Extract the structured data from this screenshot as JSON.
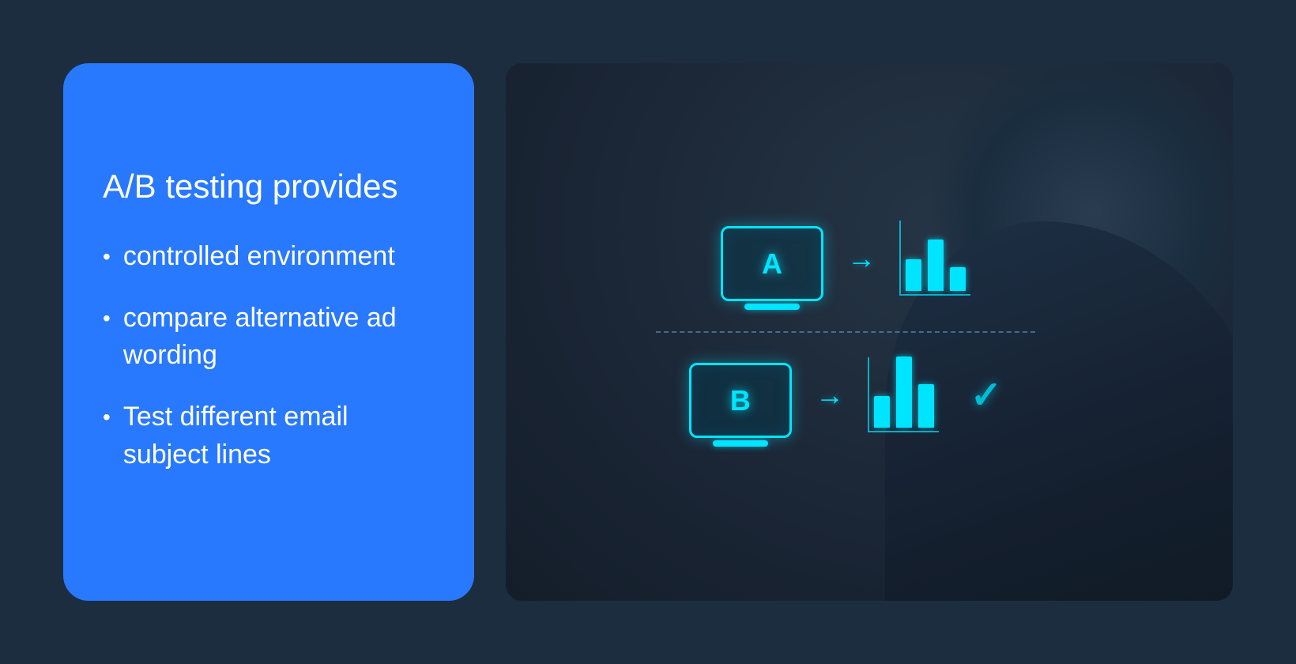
{
  "card": {
    "title": "A/B testing provides",
    "bullets": [
      {
        "id": 1,
        "bullet_char": "•",
        "text": "controlled environment"
      },
      {
        "id": 2,
        "bullet_char": "•",
        "text": "compare alternative ad wording"
      },
      {
        "id": 3,
        "bullet_char": "•",
        "text": "Test different email subject lines"
      }
    ]
  },
  "diagram": {
    "variant_a_label": "A",
    "variant_b_label": "B",
    "arrow_char": "→",
    "checkmark_char": "✓",
    "bar_a": {
      "heights": [
        40,
        65,
        30
      ]
    },
    "bar_b": {
      "heights": [
        40,
        90,
        55
      ]
    }
  },
  "colors": {
    "accent": "#2979ff",
    "cyan": "#00e5ff",
    "bg_dark": "#1a2535"
  }
}
